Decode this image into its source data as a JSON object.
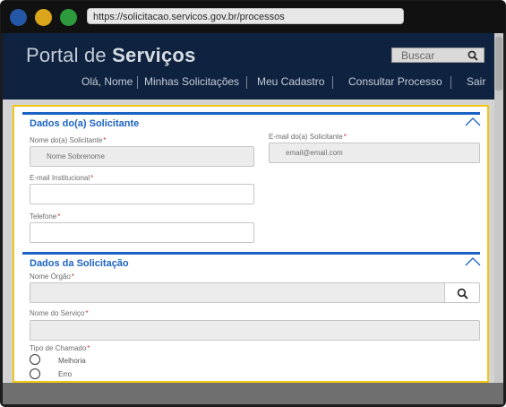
{
  "browser": {
    "url": "https://solicitacao.servicos.gov.br/processos"
  },
  "header": {
    "brand_prefix": "Portal de ",
    "brand_strong": "Serviços",
    "search_placeholder": "Buscar",
    "nav": [
      {
        "label": "Olá, Nome"
      },
      {
        "label": "Minhas Solicitações"
      },
      {
        "label": "Meu Cadastro"
      },
      {
        "label": "Consultar Processo"
      },
      {
        "label": "Sair"
      }
    ]
  },
  "form": {
    "required_mark": "*",
    "requester_section": {
      "title": "Dados do(a) Solicitante",
      "name_label": "Nome do(a) Solicitante",
      "name_value": "Nome Sobrenome",
      "email_label": "E-mail do(a) Solicitante",
      "email_value": "email@email.com",
      "institutional_email_label": "E-mail Institucional",
      "institutional_email_value": "",
      "phone_label": "Telefone",
      "phone_value": ""
    },
    "request_section": {
      "title": "Dados da Solicitação",
      "org_label": "Nome Órgão",
      "org_value": "",
      "service_label": "Nome do Serviço",
      "service_value": "",
      "type_label": "Tipo de Chamado",
      "type_options": [
        {
          "label": "Melhoria",
          "selected": false
        },
        {
          "label": "Erro",
          "selected": false
        }
      ]
    }
  },
  "colors": {
    "header_bg": "#0f2340",
    "accent": "#1a63c2",
    "highlight_border": "#f2c516",
    "required": "#c33a3a"
  }
}
